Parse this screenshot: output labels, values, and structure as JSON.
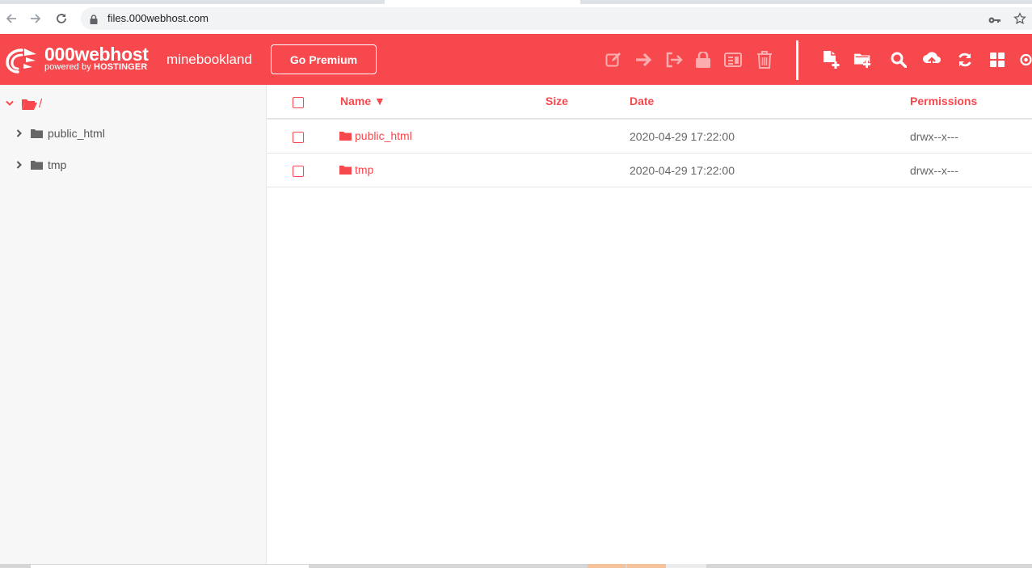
{
  "browser": {
    "url": "files.000webhost.com",
    "icons": [
      "back-icon",
      "forward-icon",
      "reload-icon",
      "lock-icon",
      "key-icon",
      "star-icon"
    ]
  },
  "header": {
    "brand_name": "000webhost",
    "brand_sub_prefix": "powered by ",
    "brand_sub_strong": "HOSTINGER",
    "site_name": "minebookland",
    "premium_label": "Go Premium",
    "accent_color": "#f6484d",
    "disabled_tools": [
      "edit-icon",
      "move-icon",
      "export-icon",
      "lock-icon",
      "archive-icon",
      "trash-icon"
    ],
    "enabled_tools": [
      "new-file-icon",
      "new-folder-icon",
      "search-icon",
      "upload-icon",
      "refresh-icon",
      "grid-view-icon",
      "settings-icon"
    ]
  },
  "sidebar": {
    "root_label": "/",
    "items": [
      {
        "label": "public_html"
      },
      {
        "label": "tmp"
      }
    ]
  },
  "table": {
    "headers": {
      "name": "Name ▼",
      "size": "Size",
      "date": "Date",
      "permissions": "Permissions"
    },
    "rows": [
      {
        "name": "public_html",
        "size": "",
        "date": "2020-04-29 17:22:00",
        "permissions": "drwx--x---"
      },
      {
        "name": "tmp",
        "size": "",
        "date": "2020-04-29 17:22:00",
        "permissions": "drwx--x---"
      }
    ]
  }
}
